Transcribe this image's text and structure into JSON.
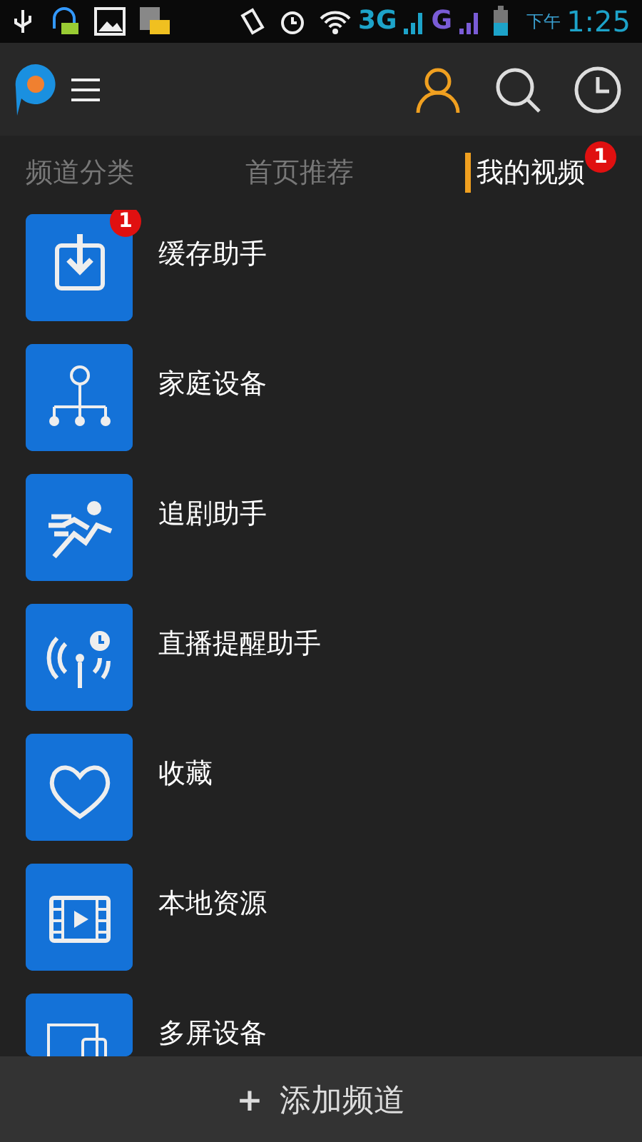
{
  "status_bar": {
    "network_1": "3G",
    "network_2": "G",
    "period": "下午",
    "time": "1:25"
  },
  "tabs": [
    {
      "label": "频道分类",
      "selected": false
    },
    {
      "label": "首页推荐",
      "selected": false
    },
    {
      "label": "我的视频",
      "selected": true,
      "badge": "1"
    }
  ],
  "items": [
    {
      "kind": "download",
      "label": "缓存助手",
      "badge": "1"
    },
    {
      "kind": "network",
      "label": "家庭设备"
    },
    {
      "kind": "run",
      "label": "追剧助手"
    },
    {
      "kind": "broadcast",
      "label": "直播提醒助手"
    },
    {
      "kind": "heart",
      "label": "收藏"
    },
    {
      "kind": "film",
      "label": "本地资源"
    },
    {
      "kind": "multiscreen",
      "label": "多屏设备"
    }
  ],
  "bottom_bar": {
    "icon": "+",
    "label": "添加频道"
  }
}
